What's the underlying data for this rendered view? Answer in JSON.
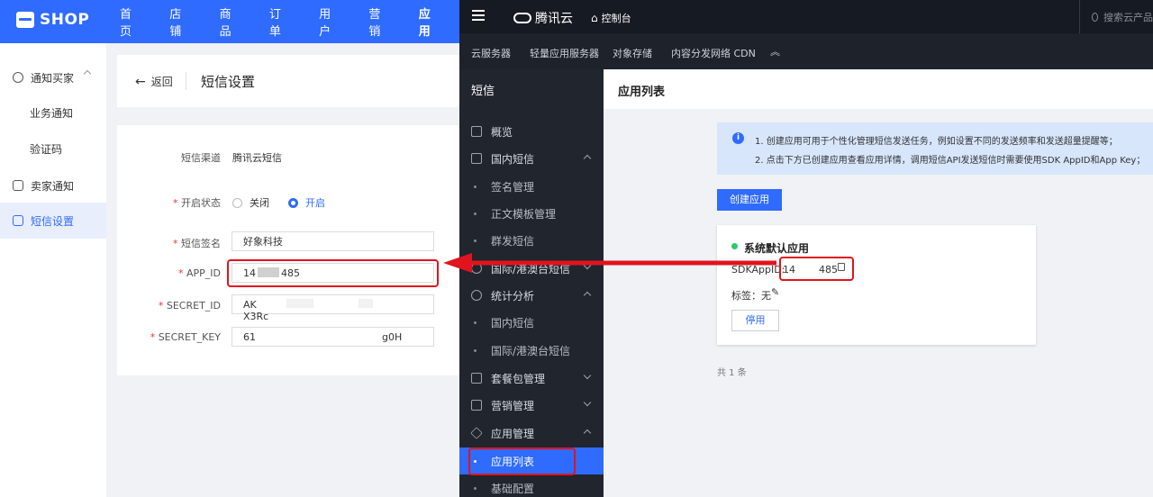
{
  "shop": {
    "logo": "SHOP",
    "nav": [
      "首页",
      "店铺",
      "商品",
      "订单",
      "用户",
      "营销",
      "应用"
    ],
    "sidebar": {
      "notify_buyer": "通知买家",
      "business_notice": "业务通知",
      "verify_code": "验证码",
      "notify_seller": "卖家通知",
      "sms_settings": "短信设置"
    },
    "back_label": "返回",
    "page_title": "短信设置",
    "form": {
      "channel_label": "短信渠道",
      "channel_value": "腾讯云短信",
      "status_label": "开启状态",
      "status_off": "关闭",
      "status_on": "开启",
      "sign_label": "短信签名",
      "sign_value": "好象科技",
      "appid_label": "APP_ID",
      "appid_value_a": "14",
      "appid_value_b": "485",
      "secret_id_label": "SECRET_ID",
      "secret_id_a": "AK",
      "secret_id_b": "X3Rc",
      "secret_key_label": "SECRET_KEY",
      "secret_key_a": "61",
      "secret_key_b": "g0H"
    }
  },
  "tencent": {
    "brand": "腾讯云",
    "console": "控制台",
    "search_placeholder": "搜索云产品",
    "subnav": [
      "云服务器",
      "轻量应用服务器",
      "对象存储",
      "内容分发网络 CDN"
    ],
    "sidebar_title": "短信",
    "sidebar": {
      "overview": "概览",
      "domestic": "国内短信",
      "sign_mgmt": "签名管理",
      "template_mgmt": "正文模板管理",
      "group_send": "群发短信",
      "intl": "国际/港澳台短信",
      "stats": "统计分析",
      "stats_domestic": "国内短信",
      "stats_intl": "国际/港澳台短信",
      "package": "套餐包管理",
      "marketing": "营销管理",
      "app_mgmt": "应用管理",
      "app_list": "应用列表",
      "basic_config": "基础配置"
    },
    "page_title": "应用列表",
    "info": [
      "1. 创建应用可用于个性化管理短信发送任务，例如设置不同的发送频率和发送超量提醒等；",
      "2. 点击下方已创建应用查看应用详情，调用短信API发送短信时需要使用SDK AppID和App Key；"
    ],
    "create_button": "创建应用",
    "card": {
      "name": "系统默认应用",
      "sdk_label": "SDKAppID:",
      "sdk_a": "14",
      "sdk_b": "485",
      "tag_label": "标签：无",
      "disable_button": "停用"
    },
    "total": "共 1 条"
  }
}
